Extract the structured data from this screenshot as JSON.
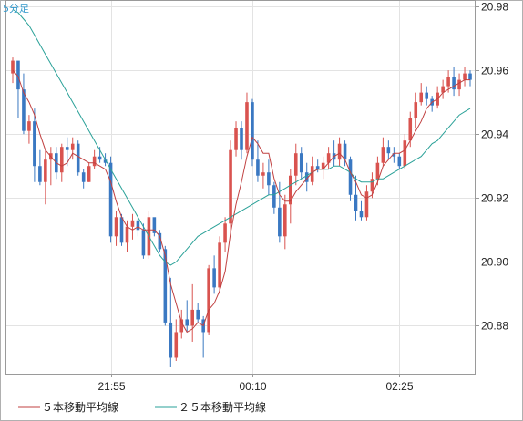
{
  "timeframe_label": "5分足",
  "colors": {
    "up": "#d9534f",
    "down": "#3a78c2",
    "ma5": "#c04040",
    "ma25": "#2aa198",
    "grid": "#e3e3e3",
    "frame": "#9a9a9a"
  },
  "chart_data": {
    "type": "candlestick",
    "title": "",
    "y_ticks": [
      "20.98",
      "20.96",
      "20.94",
      "20.92",
      "20.90",
      "20.88"
    ],
    "x_ticks": [
      "21:55",
      "00:10",
      "02:25"
    ],
    "ylim": [
      20.865,
      20.982
    ],
    "grid": true,
    "legend_position": "bottom-left",
    "series": [
      {
        "name": "５本移動平均線",
        "color": "#c04040"
      },
      {
        "name": "２５本移動平均線",
        "color": "#2aa198"
      }
    ],
    "candles": [
      [
        20.959,
        20.964,
        20.956,
        20.963
      ],
      [
        20.963,
        20.962,
        20.945,
        20.954
      ],
      [
        20.954,
        20.959,
        20.94,
        20.941
      ],
      [
        20.941,
        20.946,
        20.937,
        20.944
      ],
      [
        20.944,
        20.948,
        20.925,
        20.93
      ],
      [
        20.93,
        20.935,
        20.924,
        20.925
      ],
      [
        20.925,
        20.935,
        20.918,
        20.932
      ],
      [
        20.932,
        20.936,
        20.924,
        20.934
      ],
      [
        20.934,
        20.936,
        20.926,
        20.928
      ],
      [
        20.928,
        20.937,
        20.925,
        20.936
      ],
      [
        20.936,
        20.939,
        20.93,
        20.935
      ],
      [
        20.935,
        20.939,
        20.932,
        20.937
      ],
      [
        20.937,
        20.938,
        20.927,
        20.928
      ],
      [
        20.928,
        20.929,
        20.923,
        20.925
      ],
      [
        20.925,
        20.931,
        20.925,
        20.93
      ],
      [
        20.93,
        20.935,
        20.929,
        20.933
      ],
      [
        20.933,
        20.936,
        20.931,
        20.932
      ],
      [
        20.932,
        20.934,
        20.93,
        20.931
      ],
      [
        20.931,
        20.933,
        20.906,
        20.908
      ],
      [
        20.908,
        20.916,
        20.905,
        20.914
      ],
      [
        20.914,
        20.915,
        20.905,
        20.906
      ],
      [
        20.906,
        20.913,
        20.903,
        20.911
      ],
      [
        20.911,
        20.915,
        20.907,
        20.913
      ],
      [
        20.913,
        20.914,
        20.908,
        20.91
      ],
      [
        20.91,
        20.912,
        20.901,
        20.902
      ],
      [
        20.902,
        20.916,
        20.901,
        20.914
      ],
      [
        20.914,
        20.912,
        20.908,
        20.909
      ],
      [
        20.909,
        20.91,
        20.903,
        20.904
      ],
      [
        20.904,
        20.905,
        20.88,
        20.881
      ],
      [
        20.881,
        20.895,
        20.867,
        20.87
      ],
      [
        20.87,
        20.882,
        20.869,
        20.878
      ],
      [
        20.878,
        20.885,
        20.876,
        20.882
      ],
      [
        20.882,
        20.888,
        20.878,
        20.88
      ],
      [
        20.88,
        20.893,
        20.875,
        20.885
      ],
      [
        20.885,
        20.887,
        20.881,
        20.882
      ],
      [
        20.882,
        20.883,
        20.87,
        20.878
      ],
      [
        20.878,
        20.899,
        20.877,
        20.898
      ],
      [
        20.898,
        20.902,
        20.89,
        20.892
      ],
      [
        20.892,
        20.908,
        20.89,
        20.906
      ],
      [
        20.906,
        20.914,
        20.903,
        20.912
      ],
      [
        20.912,
        20.938,
        20.908,
        20.935
      ],
      [
        20.935,
        20.944,
        20.933,
        20.942
      ],
      [
        20.942,
        20.944,
        20.932,
        20.935
      ],
      [
        20.935,
        20.953,
        20.934,
        20.95
      ],
      [
        20.95,
        20.951,
        20.93,
        20.932
      ],
      [
        20.932,
        20.938,
        20.925,
        20.927
      ],
      [
        20.927,
        20.931,
        20.923,
        20.928
      ],
      [
        20.928,
        20.932,
        20.921,
        20.924
      ],
      [
        20.924,
        20.925,
        20.915,
        20.917
      ],
      [
        20.917,
        20.925,
        20.906,
        20.908
      ],
      [
        20.908,
        20.921,
        20.904,
        20.918
      ],
      [
        20.918,
        20.929,
        20.912,
        20.927
      ],
      [
        20.927,
        20.937,
        20.924,
        20.934
      ],
      [
        20.934,
        20.936,
        20.926,
        20.928
      ],
      [
        20.928,
        20.931,
        20.922,
        20.925
      ],
      [
        20.925,
        20.933,
        20.924,
        20.93
      ],
      [
        20.93,
        20.932,
        20.928,
        20.929
      ],
      [
        20.929,
        20.933,
        20.926,
        20.931
      ],
      [
        20.931,
        20.936,
        20.929,
        20.934
      ],
      [
        20.934,
        20.938,
        20.93,
        20.932
      ],
      [
        20.932,
        20.939,
        20.93,
        20.937
      ],
      [
        20.937,
        20.938,
        20.93,
        20.932
      ],
      [
        20.932,
        20.933,
        20.919,
        20.921
      ],
      [
        20.921,
        20.927,
        20.913,
        20.916
      ],
      [
        20.916,
        20.919,
        20.913,
        20.914
      ],
      [
        20.914,
        20.924,
        20.913,
        20.922
      ],
      [
        20.922,
        20.928,
        20.92,
        20.926
      ],
      [
        20.926,
        20.933,
        20.924,
        20.931
      ],
      [
        20.931,
        20.939,
        20.93,
        20.936
      ],
      [
        20.936,
        20.938,
        20.932,
        20.934
      ],
      [
        20.934,
        20.936,
        20.931,
        20.933
      ],
      [
        20.933,
        20.934,
        20.929,
        20.93
      ],
      [
        20.93,
        20.94,
        20.929,
        20.938
      ],
      [
        20.938,
        20.947,
        20.936,
        20.945
      ],
      [
        20.945,
        20.953,
        20.942,
        20.95
      ],
      [
        20.95,
        20.956,
        20.949,
        20.953
      ],
      [
        20.953,
        20.955,
        20.949,
        20.951
      ],
      [
        20.951,
        20.952,
        20.947,
        20.949
      ],
      [
        20.949,
        20.955,
        20.948,
        20.953
      ],
      [
        20.953,
        20.957,
        20.951,
        20.955
      ],
      [
        20.955,
        20.96,
        20.953,
        20.958
      ],
      [
        20.958,
        20.961,
        20.952,
        20.954
      ],
      [
        20.954,
        20.959,
        20.952,
        20.957
      ],
      [
        20.957,
        20.961,
        20.955,
        20.959
      ],
      [
        20.959,
        20.96,
        20.955,
        20.957
      ]
    ],
    "ma5": [
      20.96,
      20.958,
      20.953,
      20.95,
      20.946,
      20.94,
      20.935,
      20.933,
      20.931,
      20.93,
      20.931,
      20.934,
      20.933,
      20.932,
      20.931,
      20.931,
      20.93,
      20.929,
      20.925,
      20.919,
      20.914,
      20.911,
      20.91,
      20.911,
      20.91,
      20.91,
      20.91,
      20.908,
      20.902,
      20.893,
      20.887,
      20.881,
      20.878,
      20.879,
      20.881,
      20.88,
      20.885,
      20.887,
      20.891,
      20.897,
      20.909,
      20.918,
      20.925,
      20.933,
      20.939,
      20.937,
      20.934,
      20.934,
      20.926,
      20.921,
      20.919,
      20.919,
      20.922,
      20.924,
      20.926,
      20.928,
      20.929,
      20.929,
      20.931,
      20.933,
      20.934,
      20.932,
      20.928,
      20.925,
      20.921,
      20.92,
      20.921,
      20.925,
      20.93,
      20.932,
      20.934,
      20.934,
      20.935,
      20.938,
      20.941,
      20.944,
      20.948,
      20.95,
      20.951,
      20.953,
      20.954,
      20.955,
      20.956,
      20.957,
      20.957
    ],
    "ma25": [
      20.979,
      20.978,
      20.976,
      20.974,
      20.971,
      20.968,
      20.965,
      20.962,
      20.959,
      20.956,
      20.953,
      20.95,
      20.947,
      20.944,
      20.941,
      20.938,
      20.935,
      20.932,
      20.929,
      20.926,
      20.923,
      20.92,
      20.917,
      20.914,
      20.911,
      20.908,
      20.905,
      20.902,
      20.9,
      20.899,
      20.9,
      20.902,
      20.904,
      20.906,
      20.908,
      20.909,
      20.91,
      20.911,
      20.912,
      20.913,
      20.914,
      20.915,
      20.916,
      20.917,
      20.918,
      20.919,
      20.92,
      20.921,
      20.921,
      20.922,
      20.923,
      20.924,
      20.925,
      20.926,
      20.927,
      20.928,
      20.929,
      20.929,
      20.929,
      20.93,
      20.93,
      20.929,
      20.928,
      20.926,
      20.925,
      20.925,
      20.925,
      20.926,
      20.926,
      20.927,
      20.928,
      20.929,
      20.93,
      20.931,
      20.932,
      20.933,
      20.935,
      20.937,
      20.938,
      20.94,
      20.942,
      20.944,
      20.946,
      20.947,
      20.948
    ]
  }
}
